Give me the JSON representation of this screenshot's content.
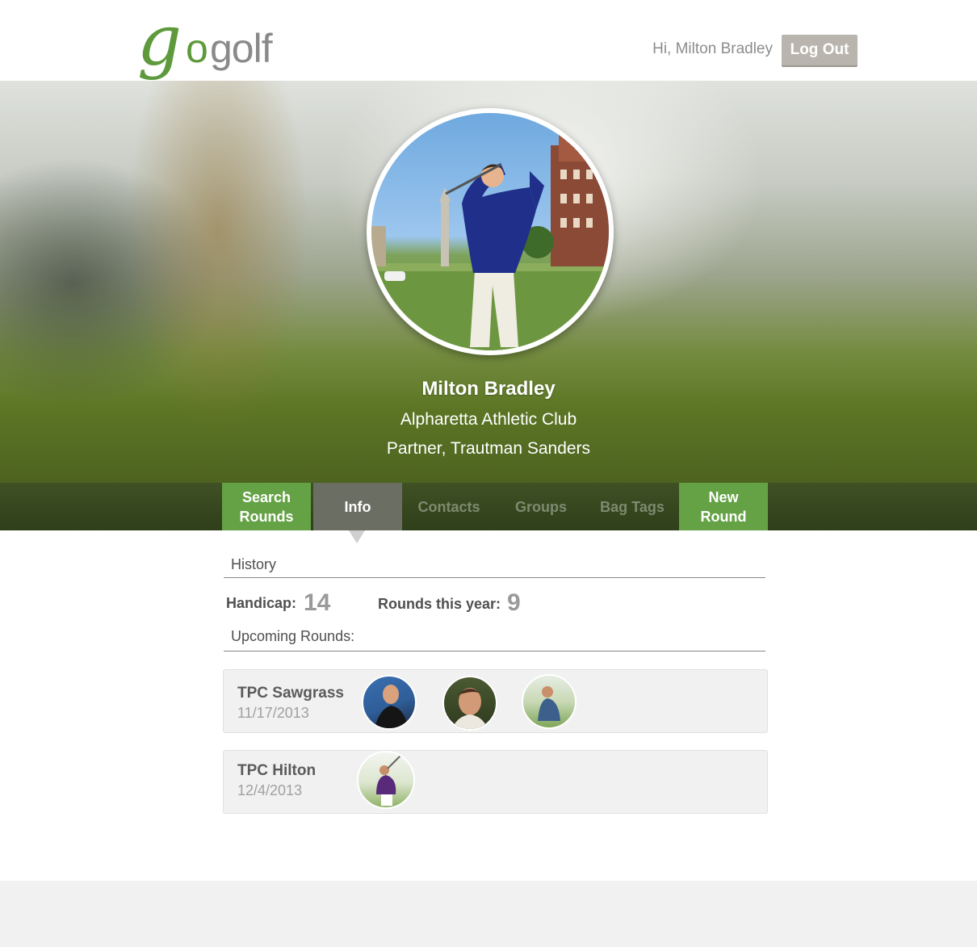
{
  "header": {
    "logo_g": "g",
    "logo_o": "o",
    "logo_rest": "golf",
    "greeting": "Hi, Milton Bradley",
    "logout_label": "Log Out"
  },
  "profile": {
    "name": "Milton Bradley",
    "club": "Alpharetta Athletic Club",
    "job": "Partner, Trautman Sanders"
  },
  "tabs": {
    "search_rounds": "Search\nRounds",
    "info": "Info",
    "contacts": "Contacts",
    "groups": "Groups",
    "bag_tags": "Bag Tags",
    "new_round": "New\nRound"
  },
  "info": {
    "history_label": "History",
    "handicap_label": "Handicap:",
    "handicap_value": "14",
    "rounds_label": "Rounds this year:",
    "rounds_value": "9",
    "upcoming_label": "Upcoming Rounds:"
  },
  "rounds": [
    {
      "course": "TPC Sawgrass",
      "date": "11/17/2013"
    },
    {
      "course": "TPC Hilton",
      "date": "12/4/2013"
    }
  ],
  "colors": {
    "brand_green": "#64a245",
    "logo_green": "#5e9a3c",
    "logout_bg": "#b9b4ae",
    "active_tab": "#6b6e62"
  }
}
